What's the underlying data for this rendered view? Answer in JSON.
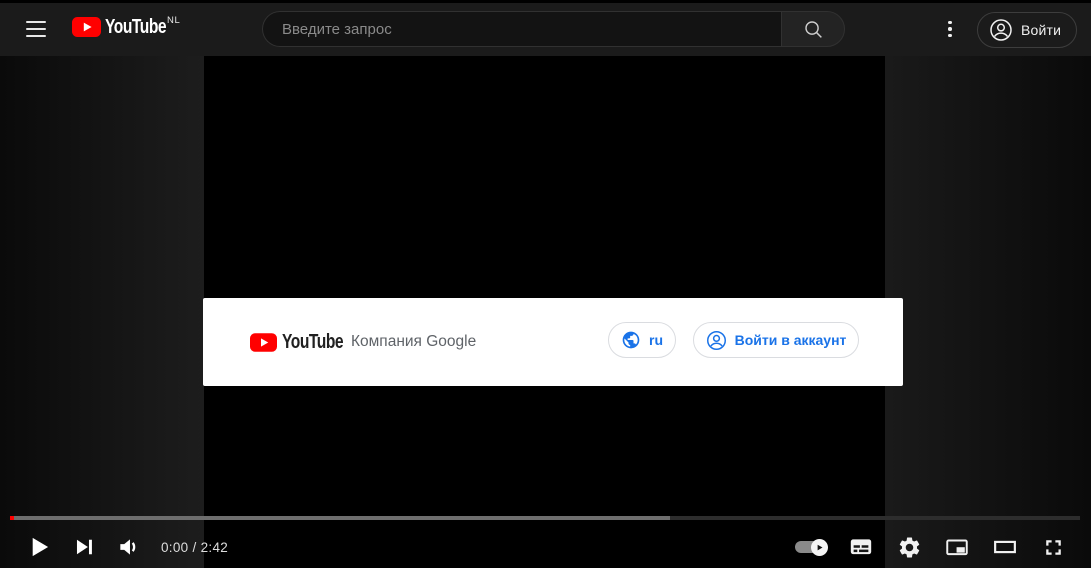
{
  "header": {
    "brand": "YouTube",
    "country_code": "NL",
    "search_placeholder": "Введите запрос",
    "signin_label": "Войти"
  },
  "consent_banner": {
    "brand": "YouTube",
    "company_label": "Компания Google",
    "language_button_label": "ru",
    "signin_button_label": "Войти в аккаунт"
  },
  "player": {
    "time_current": "0:00",
    "time_duration": "2:42",
    "time_display": "0:00 / 2:42",
    "progress": {
      "played_pct": 0.4,
      "buffered_pct": 61.7
    }
  },
  "colors": {
    "youtube_red": "#ff0000",
    "link_blue": "#1a73e8",
    "header_bg": "#1b1b1b",
    "banner_bg": "#ffffff",
    "progress_played": "#ff0000",
    "progress_buffered": "#6e6e6e",
    "progress_track": "#2d2d2d"
  },
  "icons": {
    "menu": "hamburger",
    "search": "magnifier",
    "more": "vertical-dots",
    "signin_avatar": "person-in-circle",
    "globe": "globe",
    "play": "triangle",
    "next": "triangle-with-bar",
    "volume": "speaker-with-wave",
    "autoplay": "toggle-with-play",
    "subtitles": "cc-box",
    "settings": "gear",
    "miniplayer": "picture-in-picture",
    "theater": "wide-rectangle",
    "fullscreen": "corner-brackets"
  }
}
